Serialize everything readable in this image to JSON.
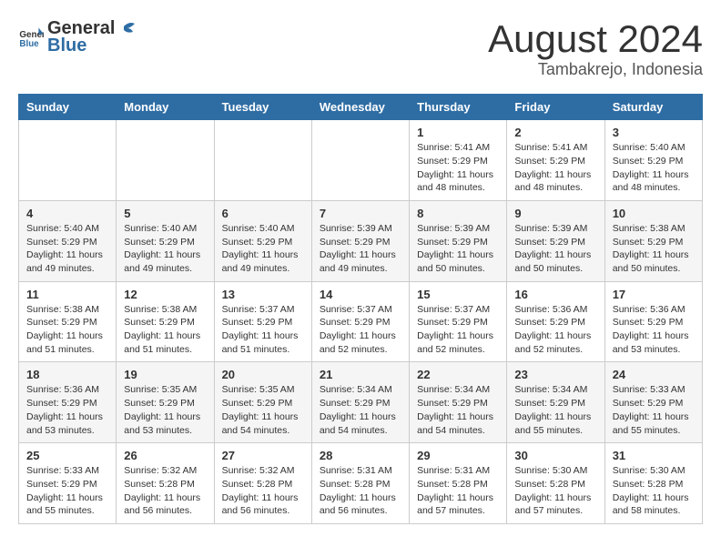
{
  "header": {
    "logo_general": "General",
    "logo_blue": "Blue",
    "month_year": "August 2024",
    "location": "Tambakrejo, Indonesia"
  },
  "days_of_week": [
    "Sunday",
    "Monday",
    "Tuesday",
    "Wednesday",
    "Thursday",
    "Friday",
    "Saturday"
  ],
  "weeks": [
    [
      {
        "day": "",
        "info": ""
      },
      {
        "day": "",
        "info": ""
      },
      {
        "day": "",
        "info": ""
      },
      {
        "day": "",
        "info": ""
      },
      {
        "day": "1",
        "info": "Sunrise: 5:41 AM\nSunset: 5:29 PM\nDaylight: 11 hours and 48 minutes."
      },
      {
        "day": "2",
        "info": "Sunrise: 5:41 AM\nSunset: 5:29 PM\nDaylight: 11 hours and 48 minutes."
      },
      {
        "day": "3",
        "info": "Sunrise: 5:40 AM\nSunset: 5:29 PM\nDaylight: 11 hours and 48 minutes."
      }
    ],
    [
      {
        "day": "4",
        "info": "Sunrise: 5:40 AM\nSunset: 5:29 PM\nDaylight: 11 hours and 49 minutes."
      },
      {
        "day": "5",
        "info": "Sunrise: 5:40 AM\nSunset: 5:29 PM\nDaylight: 11 hours and 49 minutes."
      },
      {
        "day": "6",
        "info": "Sunrise: 5:40 AM\nSunset: 5:29 PM\nDaylight: 11 hours and 49 minutes."
      },
      {
        "day": "7",
        "info": "Sunrise: 5:39 AM\nSunset: 5:29 PM\nDaylight: 11 hours and 49 minutes."
      },
      {
        "day": "8",
        "info": "Sunrise: 5:39 AM\nSunset: 5:29 PM\nDaylight: 11 hours and 50 minutes."
      },
      {
        "day": "9",
        "info": "Sunrise: 5:39 AM\nSunset: 5:29 PM\nDaylight: 11 hours and 50 minutes."
      },
      {
        "day": "10",
        "info": "Sunrise: 5:38 AM\nSunset: 5:29 PM\nDaylight: 11 hours and 50 minutes."
      }
    ],
    [
      {
        "day": "11",
        "info": "Sunrise: 5:38 AM\nSunset: 5:29 PM\nDaylight: 11 hours and 51 minutes."
      },
      {
        "day": "12",
        "info": "Sunrise: 5:38 AM\nSunset: 5:29 PM\nDaylight: 11 hours and 51 minutes."
      },
      {
        "day": "13",
        "info": "Sunrise: 5:37 AM\nSunset: 5:29 PM\nDaylight: 11 hours and 51 minutes."
      },
      {
        "day": "14",
        "info": "Sunrise: 5:37 AM\nSunset: 5:29 PM\nDaylight: 11 hours and 52 minutes."
      },
      {
        "day": "15",
        "info": "Sunrise: 5:37 AM\nSunset: 5:29 PM\nDaylight: 11 hours and 52 minutes."
      },
      {
        "day": "16",
        "info": "Sunrise: 5:36 AM\nSunset: 5:29 PM\nDaylight: 11 hours and 52 minutes."
      },
      {
        "day": "17",
        "info": "Sunrise: 5:36 AM\nSunset: 5:29 PM\nDaylight: 11 hours and 53 minutes."
      }
    ],
    [
      {
        "day": "18",
        "info": "Sunrise: 5:36 AM\nSunset: 5:29 PM\nDaylight: 11 hours and 53 minutes."
      },
      {
        "day": "19",
        "info": "Sunrise: 5:35 AM\nSunset: 5:29 PM\nDaylight: 11 hours and 53 minutes."
      },
      {
        "day": "20",
        "info": "Sunrise: 5:35 AM\nSunset: 5:29 PM\nDaylight: 11 hours and 54 minutes."
      },
      {
        "day": "21",
        "info": "Sunrise: 5:34 AM\nSunset: 5:29 PM\nDaylight: 11 hours and 54 minutes."
      },
      {
        "day": "22",
        "info": "Sunrise: 5:34 AM\nSunset: 5:29 PM\nDaylight: 11 hours and 54 minutes."
      },
      {
        "day": "23",
        "info": "Sunrise: 5:34 AM\nSunset: 5:29 PM\nDaylight: 11 hours and 55 minutes."
      },
      {
        "day": "24",
        "info": "Sunrise: 5:33 AM\nSunset: 5:29 PM\nDaylight: 11 hours and 55 minutes."
      }
    ],
    [
      {
        "day": "25",
        "info": "Sunrise: 5:33 AM\nSunset: 5:29 PM\nDaylight: 11 hours and 55 minutes."
      },
      {
        "day": "26",
        "info": "Sunrise: 5:32 AM\nSunset: 5:28 PM\nDaylight: 11 hours and 56 minutes."
      },
      {
        "day": "27",
        "info": "Sunrise: 5:32 AM\nSunset: 5:28 PM\nDaylight: 11 hours and 56 minutes."
      },
      {
        "day": "28",
        "info": "Sunrise: 5:31 AM\nSunset: 5:28 PM\nDaylight: 11 hours and 56 minutes."
      },
      {
        "day": "29",
        "info": "Sunrise: 5:31 AM\nSunset: 5:28 PM\nDaylight: 11 hours and 57 minutes."
      },
      {
        "day": "30",
        "info": "Sunrise: 5:30 AM\nSunset: 5:28 PM\nDaylight: 11 hours and 57 minutes."
      },
      {
        "day": "31",
        "info": "Sunrise: 5:30 AM\nSunset: 5:28 PM\nDaylight: 11 hours and 58 minutes."
      }
    ]
  ]
}
